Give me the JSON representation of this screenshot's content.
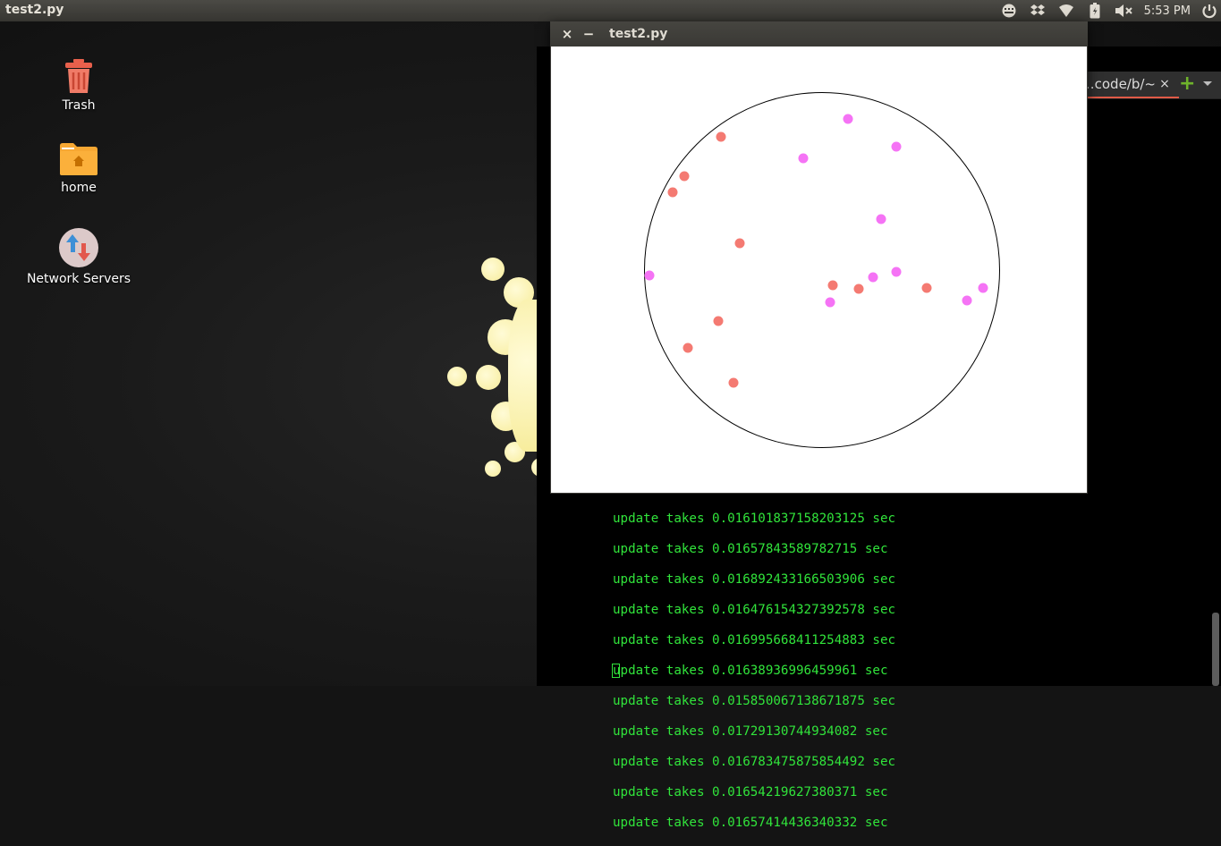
{
  "top_panel": {
    "app_title": "test2.py",
    "clock": "5:53 PM",
    "tray_icons": [
      "keyboard-icon",
      "dropbox-icon",
      "wifi-icon",
      "battery-icon",
      "volume-muted-icon",
      "power-icon"
    ]
  },
  "desktop": {
    "icons": [
      {
        "label": "Trash",
        "icon": "trash-icon"
      },
      {
        "label": "home",
        "icon": "home-folder-icon"
      },
      {
        "label": "Network Servers",
        "icon": "network-servers-icon"
      }
    ]
  },
  "terminal": {
    "tab_label": "~/code/b…",
    "tab_close": "×",
    "add_tab": "+",
    "log_lines": [
      "update takes 0.016101837158203125 sec",
      "update takes 0.01657843589782715 sec",
      "update takes 0.016892433166503906 sec",
      "update takes 0.016476154327392578 sec",
      "update takes 0.016995668411254883 sec",
      "update takes 0.01638936996459961 sec",
      "update takes 0.015850067138671875 sec",
      "update takes 0.01729130744934082 sec",
      "update takes 0.016783475875854492 sec",
      "update takes 0.01654219627380371 sec",
      "update takes 0.01657414436340332 sec"
    ]
  },
  "app_window": {
    "title": "test2.py",
    "close_label": "×",
    "minimize_label": "−",
    "colors": {
      "red_particle": "#f47a72",
      "pink_particle": "#f573f5",
      "circle_stroke": "#000000",
      "background": "#ffffff"
    }
  }
}
